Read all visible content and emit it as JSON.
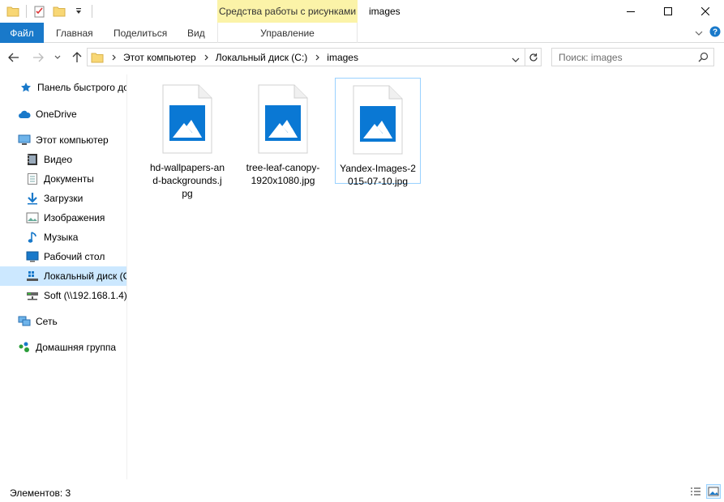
{
  "window": {
    "title": "images",
    "context_tab": "Средства работы с рисунками"
  },
  "ribbon": {
    "file": "Файл",
    "home": "Главная",
    "share": "Поделиться",
    "view": "Вид",
    "manage": "Управление"
  },
  "address": {
    "crumbs": [
      "Этот компьютер",
      "Локальный диск (C:)",
      "images"
    ]
  },
  "search": {
    "placeholder": "Поиск: images"
  },
  "sidebar": {
    "items": [
      {
        "label": "Панель быстрого доступа",
        "icon": "star-icon"
      },
      {
        "label": "OneDrive",
        "icon": "cloud-icon"
      },
      {
        "label": "Этот компьютер",
        "icon": "computer-icon"
      },
      {
        "label": "Видео",
        "icon": "video-icon"
      },
      {
        "label": "Документы",
        "icon": "documents-icon"
      },
      {
        "label": "Загрузки",
        "icon": "download-icon"
      },
      {
        "label": "Изображения",
        "icon": "pictures-icon"
      },
      {
        "label": "Музыка",
        "icon": "music-icon"
      },
      {
        "label": "Рабочий стол",
        "icon": "desktop-icon"
      },
      {
        "label": "Локальный диск (C:)",
        "icon": "drive-icon"
      },
      {
        "label": "Soft (\\\\192.168.1.4)",
        "icon": "network-drive-icon"
      },
      {
        "label": "Сеть",
        "icon": "network-icon"
      },
      {
        "label": "Домашняя группа",
        "icon": "homegroup-icon"
      }
    ]
  },
  "files": [
    {
      "name": "hd-wallpapers-and-backgrounds.jpg",
      "display": "hd-wallpapers-an\nd-backgrounds.j\npg"
    },
    {
      "name": "tree-leaf-canopy-1920x1080.jpg",
      "display": "tree-leaf-canopy-\n1920x1080.jpg"
    },
    {
      "name": "Yandex-Images-2015-07-10.jpg",
      "display": "Yandex-Images-2\n015-07-10.jpg"
    }
  ],
  "status": {
    "text": "Элементов: 3"
  },
  "colors": {
    "file_tab": "#1979ca",
    "context_tab": "#fbf3a8",
    "selection": "#cce8ff",
    "image_blue": "#0a78d4"
  }
}
